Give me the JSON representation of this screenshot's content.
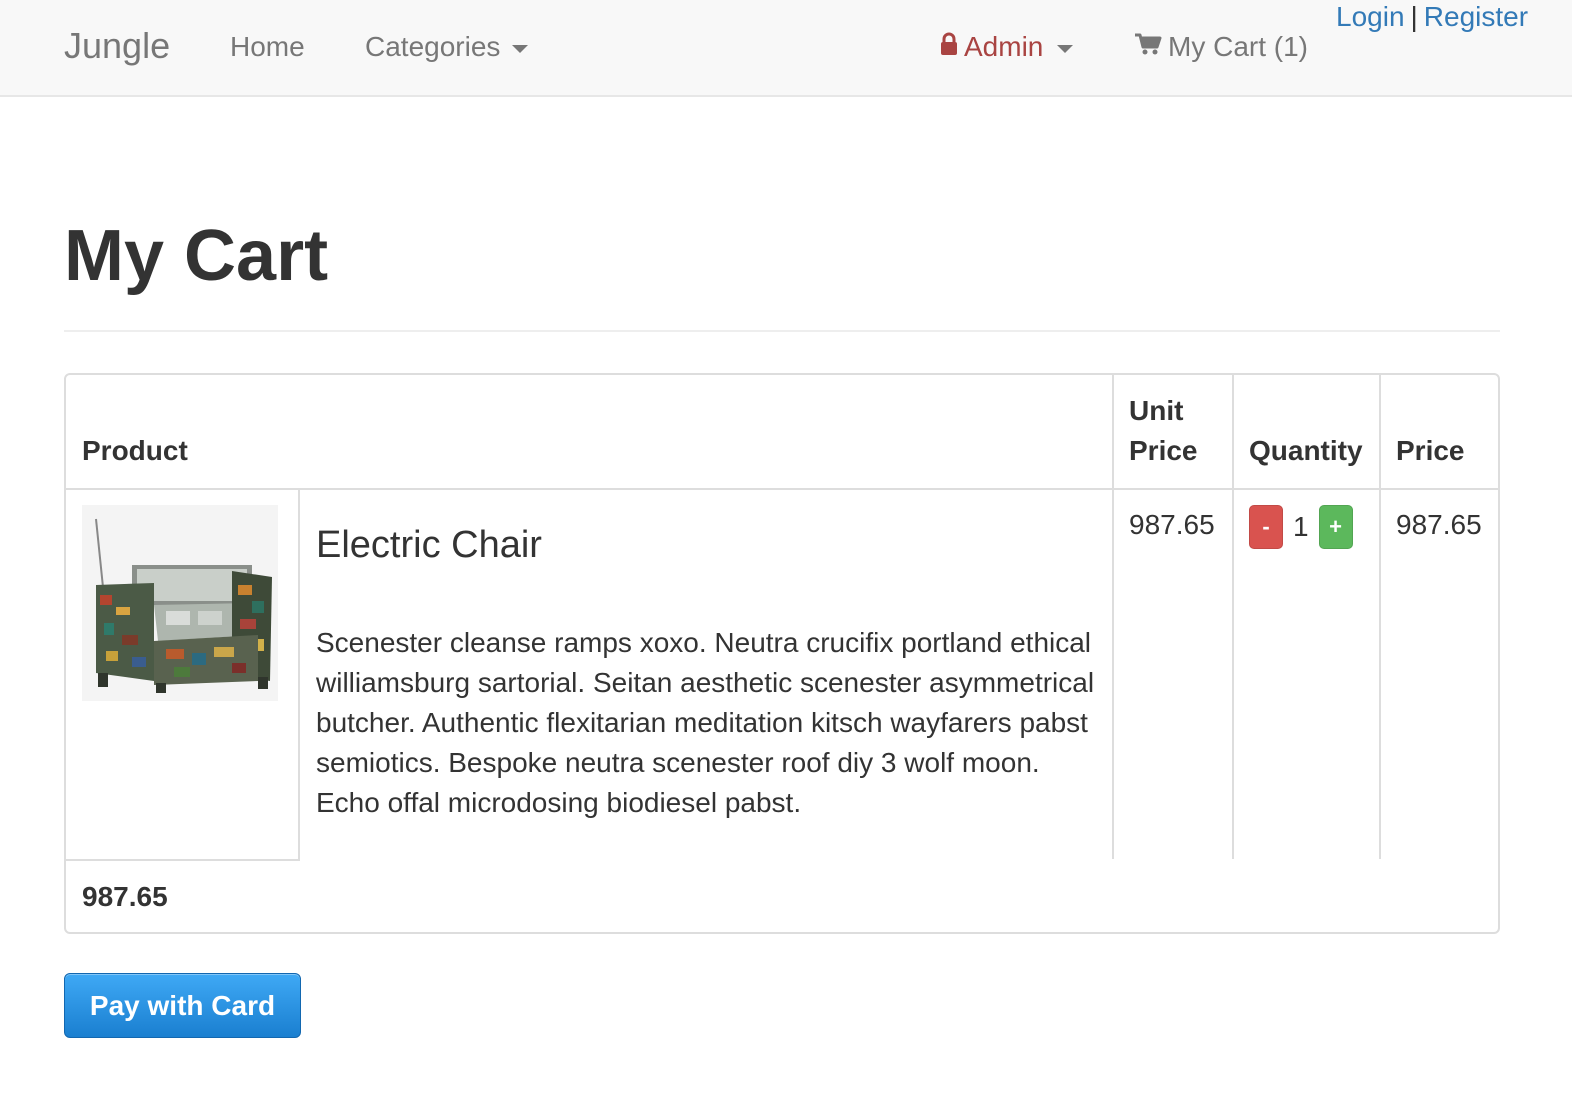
{
  "navbar": {
    "brand": "Jungle",
    "home": "Home",
    "categories": "Categories",
    "admin": "Admin",
    "cart": "My Cart (1)",
    "login": "Login",
    "separator": "|",
    "register": "Register"
  },
  "page": {
    "title": "My Cart"
  },
  "cart": {
    "headers": {
      "product": "Product",
      "unit_price_line1": "Unit",
      "unit_price_line2": "Price",
      "quantity": "Quantity",
      "price": "Price"
    },
    "item": {
      "name": "Electric Chair",
      "description": "Scenester cleanse ramps xoxo. Neutra crucifix portland ethical williamsburg sartorial. Seitan aesthetic scenester asymmetrical butcher. Authentic flexitarian meditation kitsch wayfarers pabst semiotics. Bespoke neutra scenester roof diy 3 wolf moon. Echo offal microdosing biodiesel pabst.",
      "unit_price": "987.65",
      "quantity": "1",
      "minus_label": "-",
      "plus_label": "+",
      "price": "987.65"
    },
    "total": "987.65"
  },
  "actions": {
    "pay_label": "Pay with Card"
  },
  "colors": {
    "link": "#337ab7",
    "admin": "#a94442",
    "minus": "#d9534f",
    "plus": "#5cb85c",
    "pay": "#1a7fd0"
  },
  "icons": {
    "admin": "lock-icon",
    "cart": "shopping-cart-icon"
  }
}
